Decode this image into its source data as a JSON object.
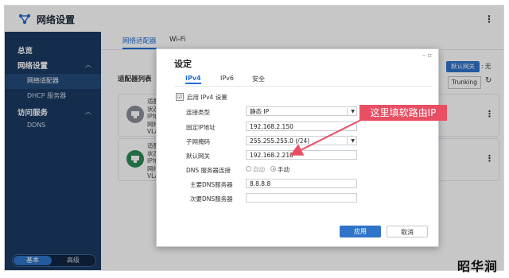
{
  "app": {
    "title": "网络设置",
    "icon": "network-settings-icon"
  },
  "sidebar": {
    "items": [
      {
        "label": "总览",
        "type": "head"
      },
      {
        "label": "网络设置",
        "type": "head"
      },
      {
        "label": "网络适配器",
        "type": "sub",
        "active": true
      },
      {
        "label": "DHCP 服务器",
        "type": "sub"
      },
      {
        "label": "访问服务",
        "type": "head"
      },
      {
        "label": "DDNS",
        "type": "sub"
      }
    ],
    "mode_basic": "基本",
    "mode_advanced": "高级",
    "mode_selected": "基本"
  },
  "main": {
    "tabs": [
      {
        "label": "网络适配器",
        "active": true
      },
      {
        "label": "Wi-Fi",
        "active": false
      }
    ],
    "adapter_list_title": "适配器列表",
    "default_gateway_btn": "默认网关",
    "none_text": ": 无",
    "trunking_btn": "Trunking",
    "cards": [
      {
        "lines": [
          "适配",
          "状态",
          "IP地",
          "网络",
          "VLA"
        ]
      },
      {
        "lines": [
          "适配",
          "状态",
          "IP地",
          "网络",
          "VLA"
        ]
      }
    ]
  },
  "dialog": {
    "title": "设定",
    "tabs": [
      {
        "label": "IPv4",
        "active": true
      },
      {
        "label": "IPv6",
        "active": false
      },
      {
        "label": "安全",
        "active": false
      }
    ],
    "enable_ipv4_label": "启用 IPv4 设置",
    "enable_ipv4_checked": true,
    "connection_type_label": "连接类型",
    "connection_type_value": "静态 IP",
    "fixed_ip_label": "固定IP地址",
    "fixed_ip_value": "192.168.2.150",
    "subnet_label": "子网掩码",
    "subnet_value": "255.255.255.0 (/24)",
    "gateway_label": "默认网关",
    "gateway_value": "192.168.2.210",
    "dns_conn_label": "DNS 服务器连接",
    "dns_auto_label": "自动",
    "dns_manual_label": "手动",
    "dns_mode": "手动",
    "primary_dns_label": "主要DNS服务器",
    "primary_dns_value": "8.8.8.8",
    "secondary_dns_label": "次要DNS服务器",
    "secondary_dns_value": "",
    "apply_label": "应用",
    "cancel_label": "取消"
  },
  "annotation": {
    "callout_text": "这里填软路由IP",
    "color": "#e94e63"
  },
  "watermark": "昭华涧",
  "colors": {
    "accent": "#2f74c9",
    "sidebar": "#1b3a63",
    "callout": "#e94e63"
  }
}
